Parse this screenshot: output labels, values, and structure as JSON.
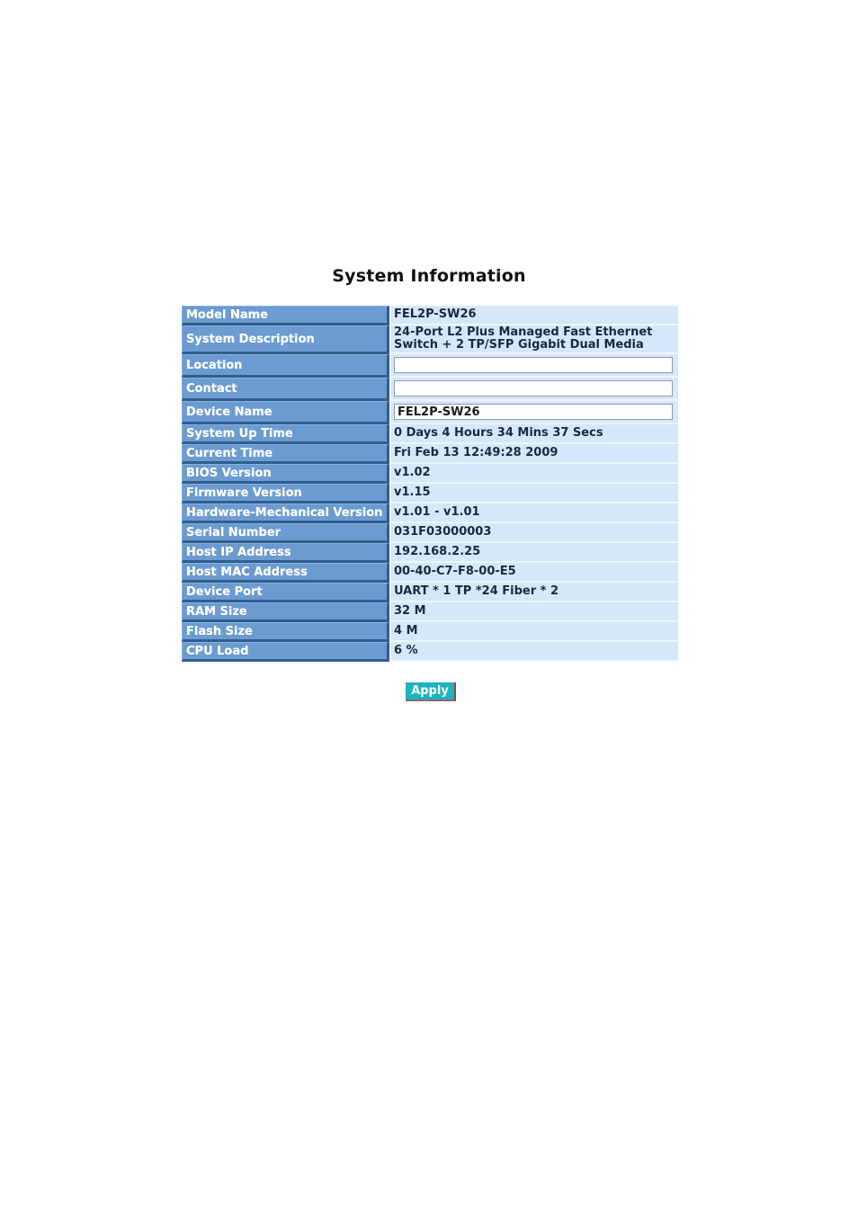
{
  "page": {
    "title": "System Information"
  },
  "rows": [
    {
      "label": "Model Name",
      "value": "FEL2P-SW26",
      "type": "text"
    },
    {
      "label": "System Description",
      "value_lines": [
        "24-Port L2 Plus Managed Fast Ethernet",
        "Switch + 2 TP/SFP Gigabit Dual Media"
      ],
      "type": "multiline"
    },
    {
      "label": "Location",
      "value": "",
      "type": "input"
    },
    {
      "label": "Contact",
      "value": "",
      "type": "input"
    },
    {
      "label": "Device Name",
      "value": "FEL2P-SW26",
      "type": "input"
    },
    {
      "label": "System Up Time",
      "value": "0 Days 4 Hours 34 Mins 37 Secs",
      "type": "text"
    },
    {
      "label": "Current Time",
      "value": "Fri Feb 13 12:49:28 2009",
      "type": "text"
    },
    {
      "label": "BIOS Version",
      "value": "v1.02",
      "type": "text"
    },
    {
      "label": "Firmware Version",
      "value": "v1.15",
      "type": "text"
    },
    {
      "label": "Hardware-Mechanical Version",
      "value": "v1.01 - v1.01",
      "type": "text"
    },
    {
      "label": "Serial Number",
      "value": "031F03000003",
      "type": "text"
    },
    {
      "label": "Host IP Address",
      "value": "192.168.2.25",
      "type": "text"
    },
    {
      "label": "Host MAC Address",
      "value": "00-40-C7-F8-00-E5",
      "type": "text"
    },
    {
      "label": "Device Port",
      "value": "UART * 1 TP *24 Fiber * 2",
      "type": "text"
    },
    {
      "label": "RAM Size",
      "value": "32 M",
      "type": "text"
    },
    {
      "label": "Flash Size",
      "value": "4 M",
      "type": "text"
    },
    {
      "label": "CPU Load",
      "value": "6 %",
      "type": "text"
    }
  ],
  "actions": {
    "apply_label": "Apply"
  },
  "colors": {
    "label_bg": "#6b9bd1",
    "value_bg": "#d5e7fa",
    "apply_bg": "#1db3bf"
  }
}
